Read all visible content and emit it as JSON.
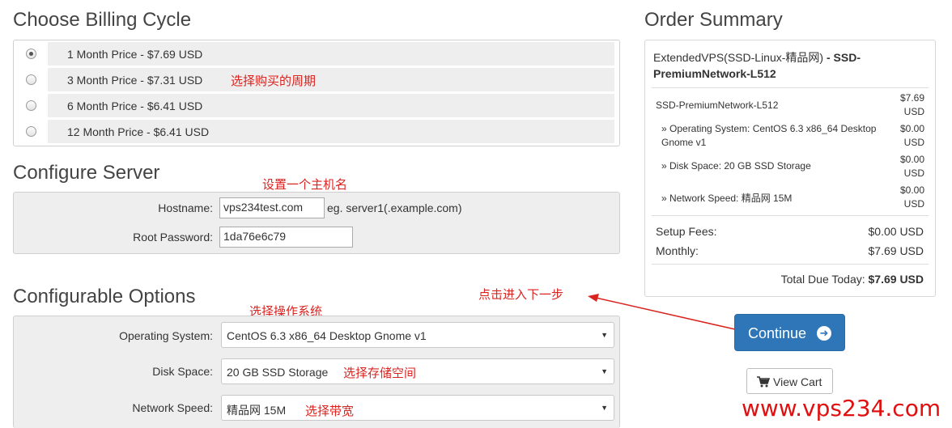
{
  "billing": {
    "title": "Choose Billing Cycle",
    "options": [
      {
        "label": "1 Month Price - $7.69 USD",
        "selected": true
      },
      {
        "label": "3 Month Price - $7.31 USD",
        "selected": false
      },
      {
        "label": "6 Month Price - $6.41 USD",
        "selected": false
      },
      {
        "label": "12 Month Price - $6.41 USD",
        "selected": false
      }
    ],
    "annotation": "选择购买的周期"
  },
  "server": {
    "title": "Configure Server",
    "annotation": "设置一个主机名",
    "hostname_label": "Hostname:",
    "hostname_value": "vps234test.com",
    "hostname_hint": "eg. server1(.example.com)",
    "password_label": "Root Password:",
    "password_value": "1da76e6c79"
  },
  "options": {
    "title": "Configurable Options",
    "annotation_os": "选择操作系统",
    "os_label": "Operating System:",
    "os_value": "CentOS 6.3 x86_64 Desktop Gnome v1",
    "disk_label": "Disk Space:",
    "disk_value": "20 GB SSD Storage",
    "annotation_disk": "选择存储空间",
    "network_label": "Network Speed:",
    "network_value": "精品网 15M",
    "annotation_network": "选择带宽"
  },
  "summary": {
    "title": "Order Summary",
    "product_name": "ExtendedVPS(SSD-Linux-精品网)",
    "product_sep": " - ",
    "product_plan": "SSD-PremiumNetwork-L512",
    "lines": [
      {
        "label": "SSD-PremiumNetwork-L512",
        "price_line1": "$7.69",
        "price_line2": "USD"
      },
      {
        "label": "» Operating System: CentOS 6.3 x86_64 Desktop Gnome v1",
        "price_line1": "$0.00",
        "price_line2": "USD"
      },
      {
        "label": "» Disk Space: 20 GB SSD Storage",
        "price_line1": "$0.00",
        "price_line2": "USD"
      },
      {
        "label": "» Network Speed: 精品网 15M",
        "price_line1": "$0.00",
        "price_line2": "USD"
      }
    ],
    "setup_label": "Setup Fees:",
    "setup_value": "$0.00 USD",
    "monthly_label": "Monthly:",
    "monthly_value": "$7.69 USD",
    "total_label": "Total Due Today: ",
    "total_value": "$7.69 USD"
  },
  "actions": {
    "annotation_next": "点击进入下一步",
    "continue_label": "Continue",
    "view_cart_label": "View Cart"
  },
  "watermark": "www.vps234.com",
  "colors": {
    "accent": "#2f76b9",
    "annotation": "#d9231f",
    "watermark": "#e01010"
  }
}
